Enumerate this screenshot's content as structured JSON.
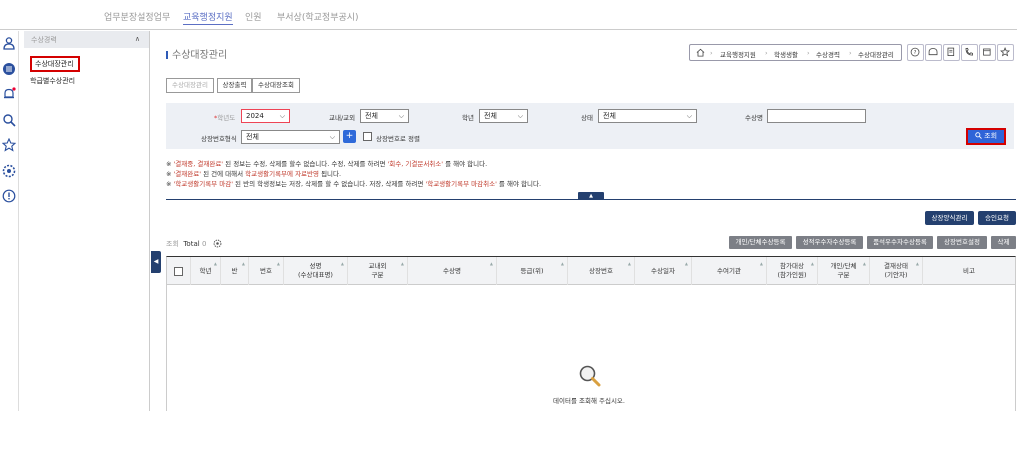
{
  "topnav": {
    "items": [
      {
        "label": "업무분장설정업무",
        "active": false
      },
      {
        "label": "교육행정지원",
        "active": true
      },
      {
        "label": "인원",
        "active": false
      },
      {
        "label": "부서상(학교정부공시)",
        "active": false
      }
    ]
  },
  "iconbar": {
    "icons": [
      "user-icon",
      "menu-icon",
      "bell-icon",
      "search-icon",
      "star-icon",
      "settings-icon",
      "info-icon"
    ]
  },
  "lnb": {
    "title": "수상경력",
    "items": [
      "수상대장관리",
      "학급별수상관리"
    ],
    "selected_index": 0
  },
  "page": {
    "title": "수상대장관리",
    "breadcrumb": [
      "교육행정지원",
      "학생생활",
      "수상경력",
      "수상대장관리"
    ]
  },
  "tabs": [
    "수상대장관리",
    "상장출력",
    "수상대장조회"
  ],
  "search": {
    "year_label": "학년도",
    "year_value": "2024",
    "inout_label": "교내/교외",
    "inout_value": "전체",
    "grade_label": "학년",
    "grade_value": "전체",
    "status_label": "상태",
    "status_value": "전체",
    "award_name_label": "수상명",
    "award_name_value": "",
    "cert_format_label": "상장번호형식",
    "cert_format_value": "전체",
    "sort_by_cert_label": "상장번호로 정렬",
    "search_button": "조회"
  },
  "notes": [
    {
      "prefix": "※ ",
      "hl": "'결재중, 결재완료'",
      "rest": " 된 정보는 수정, 삭제를 할수 없습니다. 수정, 삭제를 하려면 ",
      "hl2": "'회수, 기결문서취소'",
      "tail": " 를 해야 합니다."
    },
    {
      "prefix": "※ ",
      "hl": "'결재완료'",
      "rest": " 된 건에 대해서 ",
      "hl2": "학교생활기록부에 자료반영",
      "tail": " 됩니다."
    },
    {
      "prefix": "※ ",
      "hl": "'학교생활기록부 마감'",
      "rest": " 된 반의 학생정보는 저장, 삭제를 할 수 없습니다. 저장, 삭제를 하려면 ",
      "hl2": "'학교생활기록부 마감취소'",
      "tail": " 를 해야 합니다."
    }
  ],
  "toggle_label": "▲",
  "actions_top": [
    "상장양식관리",
    "승인요청"
  ],
  "actions_row": [
    "개인/단체수상등록",
    "성적우수자수상등록",
    "품석우수자수상등록",
    "상장번호설정",
    "삭제"
  ],
  "list": {
    "label": "조회",
    "total_label": "Total",
    "total_value": "0"
  },
  "grid": {
    "columns": [
      "학년",
      "반",
      "번호",
      "성명\n(수상대표명)",
      "교내외\n구분",
      "수상명",
      "등급(위)",
      "상장번호",
      "수상일자",
      "수여기관",
      "참가대상\n(참가인원)",
      "개인/단체\n구분",
      "결재상태\n(기안자)",
      "비고"
    ],
    "empty_message": "데이터를 조회해 주십시오."
  }
}
